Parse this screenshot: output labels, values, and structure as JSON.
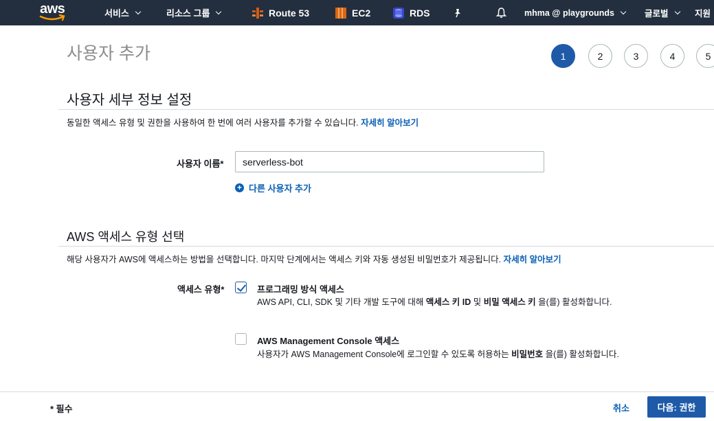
{
  "nav": {
    "logo_text": "aws",
    "services": "서비스",
    "resource_groups": "리소스 그룹",
    "favorites": [
      {
        "label": "Route 53",
        "icon": "route53-icon",
        "color": "#d05c17"
      },
      {
        "label": "EC2",
        "icon": "ec2-icon",
        "color": "#d86613"
      },
      {
        "label": "RDS",
        "icon": "rds-icon",
        "color": "#3b48cc"
      }
    ],
    "account": "mhma @ playgrounds",
    "region": "글로벌",
    "support": "지원"
  },
  "page": {
    "title": "사용자 추가",
    "steps": [
      "1",
      "2",
      "3",
      "4",
      "5"
    ],
    "active_step": "1"
  },
  "user_details": {
    "title": "사용자 세부 정보 설정",
    "description": "동일한 액세스 유형 및 권한을 사용하여 한 번에 여러 사용자를 추가할 수 있습니다.",
    "learn_more": "자세히 알아보기",
    "username_label": "사용자 이름*",
    "username_value": "serverless-bot",
    "add_another": "다른 사용자 추가"
  },
  "access_type": {
    "title": "AWS 액세스 유형 선택",
    "description": "해당 사용자가 AWS에 액세스하는 방법을 선택합니다. 마지막 단계에서는 액세스 키와 자동 생성된 비밀번호가 제공됩니다.",
    "learn_more": "자세히 알아보기",
    "label": "액세스 유형*",
    "options": [
      {
        "title": "프로그래밍 방식 액세스",
        "checked": true,
        "desc_1": "AWS API, CLI, SDK 및 기타 개발 도구에 대해 ",
        "desc_b1": "액세스 키 ID",
        "desc_2": " 및 ",
        "desc_b2": "비밀 액세스 키",
        "desc_3": " 을(를) 활성화합니다."
      },
      {
        "title": "AWS Management Console 액세스",
        "checked": false,
        "desc_1": "사용자가 AWS Management Console에 로그인할 수 있도록 허용하는 ",
        "desc_b1": "비밀번호",
        "desc_2": " 을(를) 활성화합니다."
      }
    ]
  },
  "footer": {
    "required_note": "* 필수",
    "cancel": "취소",
    "next": "다음: 권한"
  },
  "colors": {
    "nav_bg": "#232f3e",
    "primary": "#1e5aa8",
    "link": "#0a5fb4"
  }
}
